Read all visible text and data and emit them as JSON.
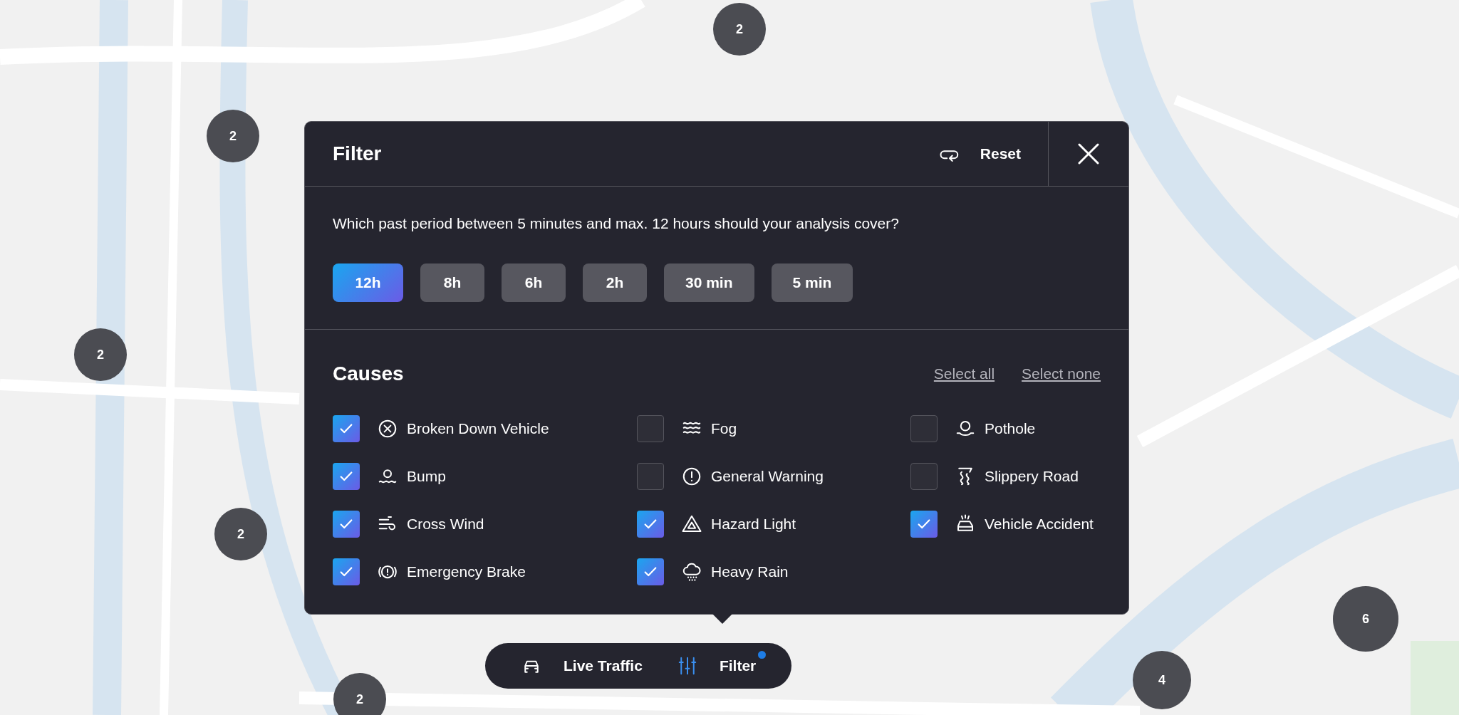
{
  "clusters": [
    {
      "count": "2"
    },
    {
      "count": "2"
    },
    {
      "count": "2"
    },
    {
      "count": "2"
    },
    {
      "count": "2"
    },
    {
      "count": "6"
    },
    {
      "count": "4"
    }
  ],
  "filter_panel": {
    "title": "Filter",
    "reset": "Reset",
    "question": "Which past period between 5 minutes and max. 12 hours should your analysis cover?",
    "periods": [
      {
        "label": "12h",
        "selected": true
      },
      {
        "label": "8h",
        "selected": false
      },
      {
        "label": "6h",
        "selected": false
      },
      {
        "label": "2h",
        "selected": false
      },
      {
        "label": "30 min",
        "selected": false
      },
      {
        "label": "5 min",
        "selected": false
      }
    ],
    "causes_title": "Causes",
    "select_all": "Select all",
    "select_none": "Select none",
    "cause_columns": [
      [
        {
          "label": "Broken Down Vehicle",
          "checked": true
        },
        {
          "label": "Bump",
          "checked": true
        },
        {
          "label": "Cross Wind",
          "checked": true
        },
        {
          "label": "Emergency Brake",
          "checked": true
        }
      ],
      [
        {
          "label": "Fog",
          "checked": false
        },
        {
          "label": "General Warning",
          "checked": false
        },
        {
          "label": "Hazard Light",
          "checked": true
        },
        {
          "label": "Heavy Rain",
          "checked": true
        }
      ],
      [
        {
          "label": "Pothole",
          "checked": false
        },
        {
          "label": "Slippery Road",
          "checked": false
        },
        {
          "label": "Vehicle Accident",
          "checked": true
        }
      ]
    ]
  },
  "bottom_bar": {
    "items": [
      {
        "label": "Live Traffic",
        "selected": false,
        "badge": false
      },
      {
        "label": "Filter",
        "selected": true,
        "badge": true
      }
    ]
  }
}
